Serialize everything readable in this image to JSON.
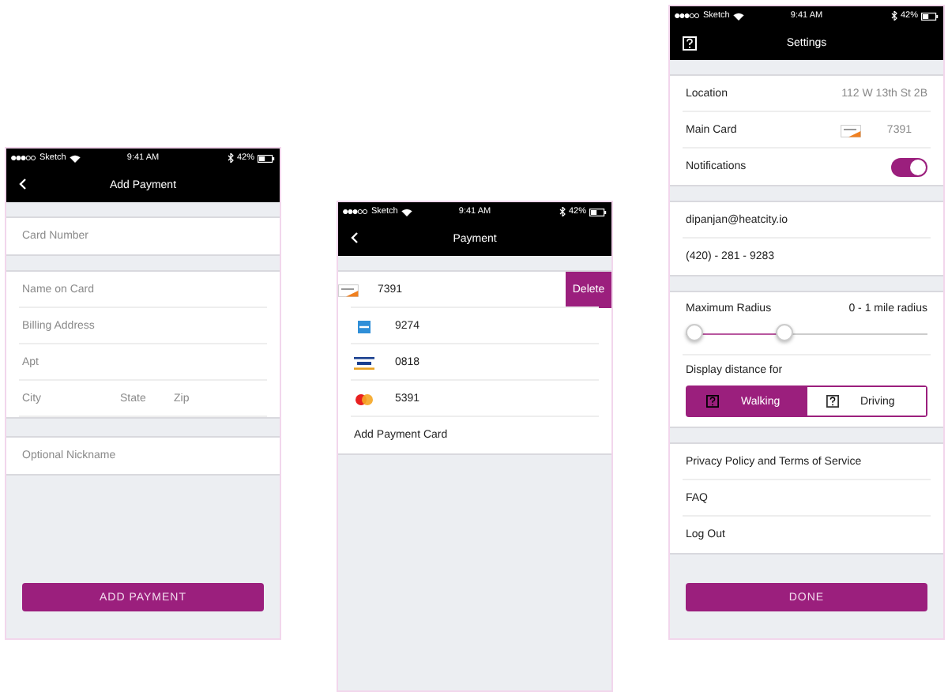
{
  "screens": [
    {
      "kind": "add_payment",
      "status_bar": {
        "carrier": "Sketch",
        "time": "9:41 AM",
        "battery": "42%"
      },
      "title": "Add Payment",
      "card_number": {
        "placeholder": "Card Number"
      },
      "address_fields": [
        {
          "placeholder": "Name on Card"
        },
        {
          "placeholder": "Billing Address"
        },
        {
          "placeholder": "Apt"
        }
      ],
      "city_row": [
        {
          "placeholder": "City"
        },
        {
          "placeholder": "State"
        },
        {
          "placeholder": "Zip"
        }
      ],
      "nickname": {
        "placeholder": "Optional Nickname"
      },
      "button": "ADD PAYMENT"
    },
    {
      "kind": "payment",
      "status_bar": {
        "carrier": "Sketch",
        "time": "9:41 AM",
        "battery": "42%"
      },
      "title": "Payment",
      "cards": [
        {
          "kind": "discover",
          "number": "7391",
          "swiped": true,
          "action": "Delete"
        },
        {
          "kind": "amex",
          "number": "9274",
          "swiped": false
        },
        {
          "kind": "visa",
          "number": "0818",
          "swiped": false
        },
        {
          "kind": "mastercard",
          "number": "5391",
          "swiped": false
        }
      ],
      "add_link": "Add Payment Card"
    },
    {
      "kind": "settings",
      "status_bar": {
        "carrier": "Sketch",
        "time": "9:41 AM",
        "battery": "42%"
      },
      "title": "Settings",
      "location": {
        "label": "Location",
        "value": "112 W 13th St 2B"
      },
      "main_card": {
        "label": "Main Card",
        "kind": "discover",
        "number": "7391"
      },
      "notifications": {
        "label": "Notifications",
        "on": true
      },
      "email": "dipanjan@heatcity.io",
      "phone": "(420) - 281 - 9283",
      "radius": {
        "label": "Maximum Radius",
        "value": "0 - 1 mile radius",
        "handles": [
          {
            "level": 0
          },
          {
            "level": 0.4
          }
        ]
      },
      "distance": {
        "label": "Display distance for",
        "options": [
          {
            "label": "Walking",
            "selected": true
          },
          {
            "label": "Driving",
            "selected": false
          }
        ]
      },
      "links": [
        "Privacy Policy and Terms of Service",
        "FAQ",
        "Log Out"
      ],
      "button": "DONE"
    }
  ]
}
